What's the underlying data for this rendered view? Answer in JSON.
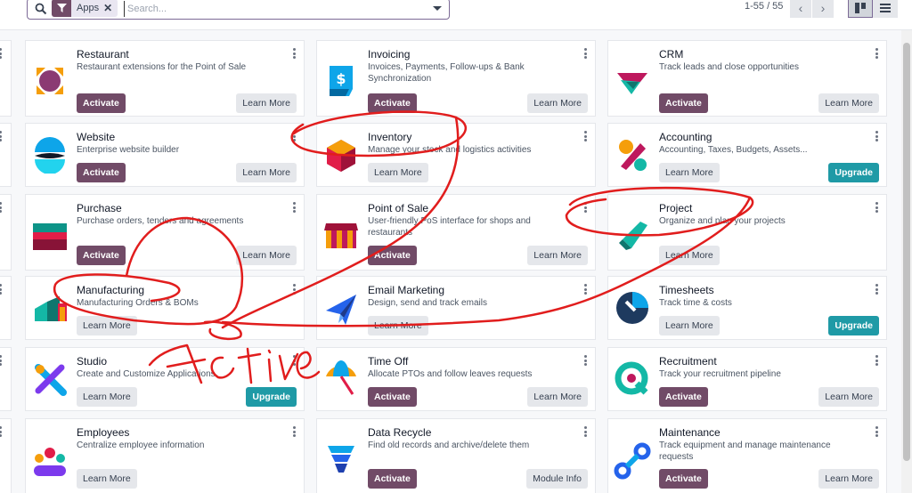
{
  "search": {
    "facet_label": "Apps",
    "placeholder": "Search..."
  },
  "pager": {
    "value": "1-55 / 55"
  },
  "annotation_text": "Active",
  "cards": [
    {
      "name": "Restaurant",
      "desc": "Restaurant extensions for the Point of Sale",
      "primary": "Activate",
      "secondary": "Learn More",
      "icon": "restaurant-icon"
    },
    {
      "name": "Invoicing",
      "desc": "Invoices, Payments, Follow-ups & Bank Synchronization",
      "primary": "Activate",
      "secondary": "Learn More",
      "icon": "invoicing-icon"
    },
    {
      "name": "CRM",
      "desc": "Track leads and close opportunities",
      "primary": "Activate",
      "secondary": "Learn More",
      "icon": "crm-icon"
    },
    {
      "name": "Website",
      "desc": "Enterprise website builder",
      "primary": "Activate",
      "secondary": "Learn More",
      "icon": "website-icon"
    },
    {
      "name": "Inventory",
      "desc": "Manage your stock and logistics activities",
      "primary": "",
      "secondary": "Learn More",
      "icon": "inventory-icon"
    },
    {
      "name": "Accounting",
      "desc": "Accounting, Taxes, Budgets, Assets...",
      "primary": "Learn More",
      "secondary": "Upgrade",
      "icon": "accounting-icon"
    },
    {
      "name": "Purchase",
      "desc": "Purchase orders, tenders and agreements",
      "primary": "Activate",
      "secondary": "Learn More",
      "icon": "purchase-icon"
    },
    {
      "name": "Point of Sale",
      "desc": "User-friendly PoS interface for shops and restaurants",
      "primary": "Activate",
      "secondary": "Learn More",
      "icon": "point-of-sale-icon"
    },
    {
      "name": "Project",
      "desc": "Organize and plan your projects",
      "primary": "Learn More",
      "secondary": "",
      "icon": "project-icon"
    },
    {
      "name": "Manufacturing",
      "desc": "Manufacturing Orders & BOMs",
      "primary": "Learn More",
      "secondary": "",
      "icon": "manufacturing-icon"
    },
    {
      "name": "Email Marketing",
      "desc": "Design, send and track emails",
      "primary": "Learn More",
      "secondary": "",
      "icon": "email-marketing-icon"
    },
    {
      "name": "Timesheets",
      "desc": "Track time & costs",
      "primary": "Learn More",
      "secondary": "Upgrade",
      "icon": "timesheets-icon"
    },
    {
      "name": "Studio",
      "desc": "Create and Customize Applications",
      "primary": "Learn More",
      "secondary": "Upgrade",
      "icon": "studio-icon"
    },
    {
      "name": "Time Off",
      "desc": "Allocate PTOs and follow leaves requests",
      "primary": "Activate",
      "secondary": "Learn More",
      "icon": "time-off-icon"
    },
    {
      "name": "Recruitment",
      "desc": "Track your recruitment pipeline",
      "primary": "Activate",
      "secondary": "Learn More",
      "icon": "recruitment-icon"
    },
    {
      "name": "Employees",
      "desc": "Centralize employee information",
      "primary": "Learn More",
      "secondary": "",
      "icon": "employees-icon"
    },
    {
      "name": "Data Recycle",
      "desc": "Find old records and archive/delete them",
      "primary": "Activate",
      "secondary": "Module Info",
      "icon": "data-recycle-icon"
    },
    {
      "name": "Maintenance",
      "desc": "Track equipment and manage maintenance requests",
      "primary": "Activate",
      "secondary": "Learn More",
      "icon": "maintenance-icon"
    }
  ]
}
